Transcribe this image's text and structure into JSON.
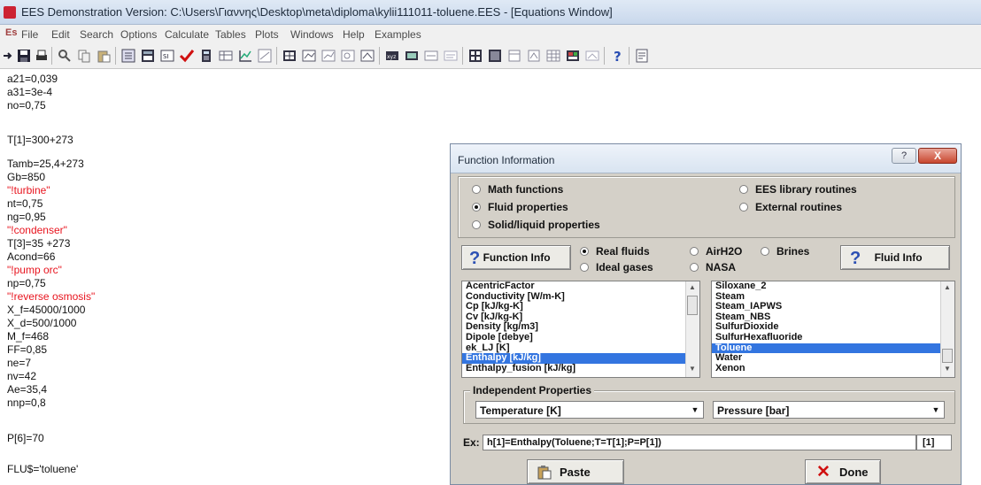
{
  "window": {
    "title": "EES Demonstration Version:  C:\\Users\\Γιαννης\\Desktop\\meta\\diploma\\kylii111011-toluene.EES - [Equations Window]"
  },
  "menu": {
    "app_icon": "Es",
    "items": [
      "File",
      "Edit",
      "Search",
      "Options",
      "Calculate",
      "Tables",
      "Plots",
      "Windows",
      "Help",
      "Examples"
    ]
  },
  "toolbar_icons": [
    "new-icon",
    "save-icon",
    "print-icon",
    "find-icon",
    "copy-icon",
    "paste-icon",
    "info-icon",
    "table-icon",
    "units-icon",
    "check-icon",
    "calculator-icon",
    "solve-table-icon",
    "plot-icon",
    "graph-icon",
    "parametric-table-icon",
    "lookup-table-icon",
    "plot-window-icon",
    "diagram-icon",
    "array-icon",
    "format-icon",
    "variable-info-icon",
    "units-check-icon",
    "equations-window-icon",
    "formatted-equations-icon",
    "solution-window-icon",
    "arrays-window-icon",
    "residuals-window-icon",
    "parametric-window-icon",
    "lookup-window-icon",
    "integral-table-icon",
    "diagram-window-icon",
    "help-icon",
    "report-icon"
  ],
  "equations": [
    {
      "text": "a21=0,039",
      "red": false
    },
    {
      "text": "a31=3e-4",
      "red": false
    },
    {
      "text": "no=0,75",
      "red": false
    },
    {
      "text": "",
      "red": false
    },
    {
      "text": "T[1]=300+273",
      "red": false
    },
    {
      "text": "",
      "red": false
    },
    {
      "text": "Tamb=25,4+273",
      "red": false
    },
    {
      "text": "Gb=850",
      "red": false
    },
    {
      "text": "\"!turbine\"",
      "red": true
    },
    {
      "text": "nt=0,75",
      "red": false
    },
    {
      "text": "ng=0,95",
      "red": false
    },
    {
      "text": "\"!condenser\"",
      "red": true
    },
    {
      "text": "T[3]=35 +273",
      "red": false
    },
    {
      "text": "Acond=66",
      "red": false
    },
    {
      "text": "\"!pump orc\"",
      "red": true
    },
    {
      "text": "np=0,75",
      "red": false
    },
    {
      "text": "\"!reverse osmosis\"",
      "red": true
    },
    {
      "text": "X_f=45000/1000",
      "red": false
    },
    {
      "text": "X_d=500/1000",
      "red": false
    },
    {
      "text": "M_f=468",
      "red": false
    },
    {
      "text": "FF=0,85",
      "red": false
    },
    {
      "text": "ne=7",
      "red": false
    },
    {
      "text": "nv=42",
      "red": false
    },
    {
      "text": "Ae=35,4",
      "red": false
    },
    {
      "text": "nnp=0,8",
      "red": false
    },
    {
      "text": "",
      "red": false
    },
    {
      "text": "P[6]=70",
      "red": false
    },
    {
      "text": "",
      "red": false
    },
    {
      "text": "FLU$='toluene'",
      "red": false
    }
  ],
  "dialog": {
    "title": "Function Information",
    "help_button": "?",
    "close_button": "X",
    "categories": {
      "math": "Math functions",
      "fluid": "Fluid properties",
      "solid": "Solid/liquid properties",
      "ees_lib": "EES library routines",
      "external": "External routines",
      "selected": "fluid"
    },
    "function_info_button": "Function Info",
    "fluid_info_button": "Fluid Info",
    "fluid_types": {
      "real": "Real fluids",
      "ideal": "Ideal gases",
      "airh2o": "AirH2O",
      "nasa": "NASA",
      "brines": "Brines",
      "selected": "real"
    },
    "functions": [
      "AcentricFactor",
      "Conductivity [W/m-K]",
      "Cp [kJ/kg-K]",
      "Cv [kJ/kg-K]",
      "Density [kg/m3]",
      "Dipole [debye]",
      "ek_LJ [K]",
      "Enthalpy [kJ/kg]",
      "Enthalpy_fusion [kJ/kg]"
    ],
    "functions_selected": 7,
    "fluids": [
      "Siloxane_2",
      "Steam",
      "Steam_IAPWS",
      "Steam_NBS",
      "SulfurDioxide",
      "SulfurHexafluoride",
      "Toluene",
      "Water",
      "Xenon"
    ],
    "fluids_selected": 6,
    "independent_label": "Independent Properties",
    "prop1": "Temperature [K]",
    "prop2": "Pressure [bar]",
    "ex_label": "Ex:",
    "example": "h[1]=Enthalpy(Toluene;T=T[1];P=P[1])",
    "index": "[1]",
    "paste_button": "Paste",
    "done_button": "Done"
  }
}
